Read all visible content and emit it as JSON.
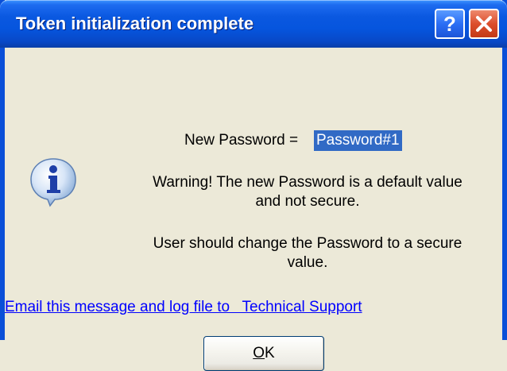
{
  "window": {
    "title": "Token initialization complete",
    "help_icon": "help-question-icon",
    "close_icon": "close-x-icon"
  },
  "message": {
    "icon": "information-icon",
    "password_label": "New Password = ",
    "password_value": "Password#1",
    "warning_line1": "Warning! The new Password is a default value",
    "warning_line2": "and not secure.",
    "user_line1": "User should change the Password to a secure",
    "user_line2": "value."
  },
  "link": {
    "email_text": "Email this message and log file to   Technical Support"
  },
  "buttons": {
    "ok_mnemonic": "O",
    "ok_rest": "K"
  },
  "colors": {
    "titlebar": "#0A58E0",
    "dialog_bg": "#ECE9D8",
    "selection": "#316AC5",
    "link": "#0000FF",
    "close_button": "#DC4E2C"
  }
}
